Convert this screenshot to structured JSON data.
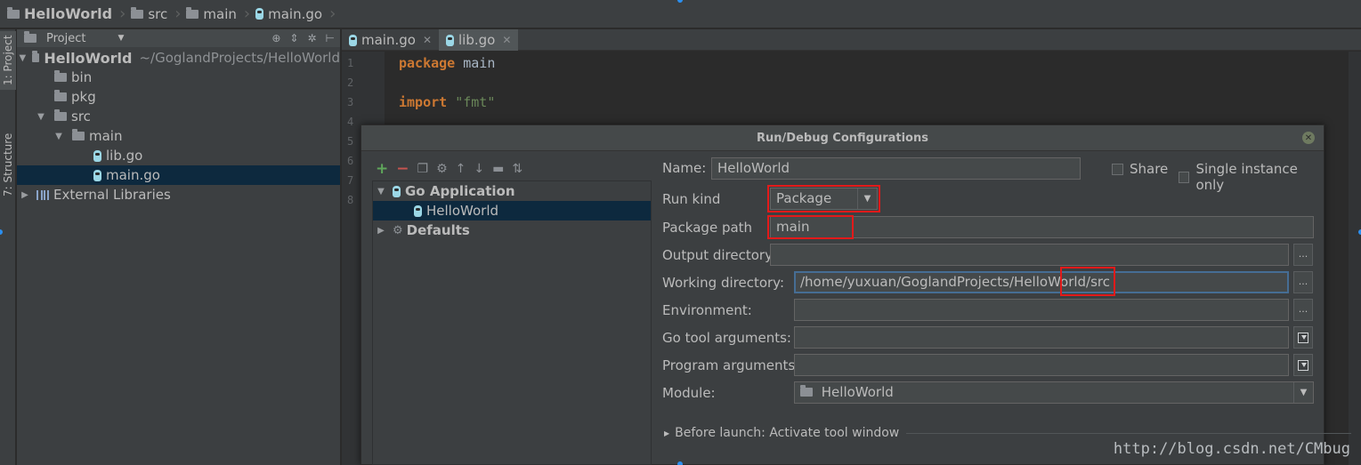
{
  "navbar": {
    "project": "HelloWorld",
    "crumb_src": "src",
    "crumb_main": "main",
    "crumb_file": "main.go"
  },
  "side_tabs": {
    "project": "1: Project",
    "structure": "7: Structure"
  },
  "project_panel": {
    "title": "Project",
    "root": {
      "name": "HelloWorld",
      "path": "~/GoglandProjects/HelloWorld"
    },
    "items": [
      {
        "label": "bin"
      },
      {
        "label": "pkg"
      },
      {
        "label": "src"
      },
      {
        "label": "main"
      },
      {
        "label": "lib.go"
      },
      {
        "label": "main.go"
      },
      {
        "label": "External Libraries"
      }
    ]
  },
  "editor": {
    "tabs": [
      {
        "label": "main.go"
      },
      {
        "label": "lib.go"
      }
    ],
    "line_numbers": [
      "1",
      "2",
      "3",
      "4",
      "5",
      "6",
      "7",
      "8"
    ],
    "code": {
      "kw_package": "package",
      "pkg_name": " main",
      "kw_import": "import",
      "import_str": " \"fmt\""
    }
  },
  "dialog": {
    "title": "Run/Debug Configurations",
    "tree": {
      "group": "Go Application",
      "config": "HelloWorld",
      "defaults": "Defaults"
    },
    "name_label": "Name:",
    "name_value": "HelloWorld",
    "share_label": "Share",
    "single_instance_label": "Single instance only",
    "run_kind_label": "Run kind",
    "run_kind_value": "Package",
    "package_path_label": "Package path",
    "package_path_value": "main",
    "output_dir_label": "Output directory",
    "output_dir_value": "",
    "working_dir_label": "Working directory:",
    "working_dir_value": "/home/yuxuan/GoglandProjects/HelloWorld/src",
    "environment_label": "Environment:",
    "go_tool_args_label": "Go tool arguments:",
    "program_args_label": "Program arguments:",
    "module_label": "Module:",
    "module_value": "HelloWorld",
    "browse_label": "...",
    "before_launch": "Before launch: Activate tool window"
  },
  "watermark": "http://blog.csdn.net/CMbug",
  "colors": {
    "annotation_box": "#e31a1a",
    "keyword": "#cc7832",
    "string": "#6a8759",
    "selection": "#0d293e"
  }
}
